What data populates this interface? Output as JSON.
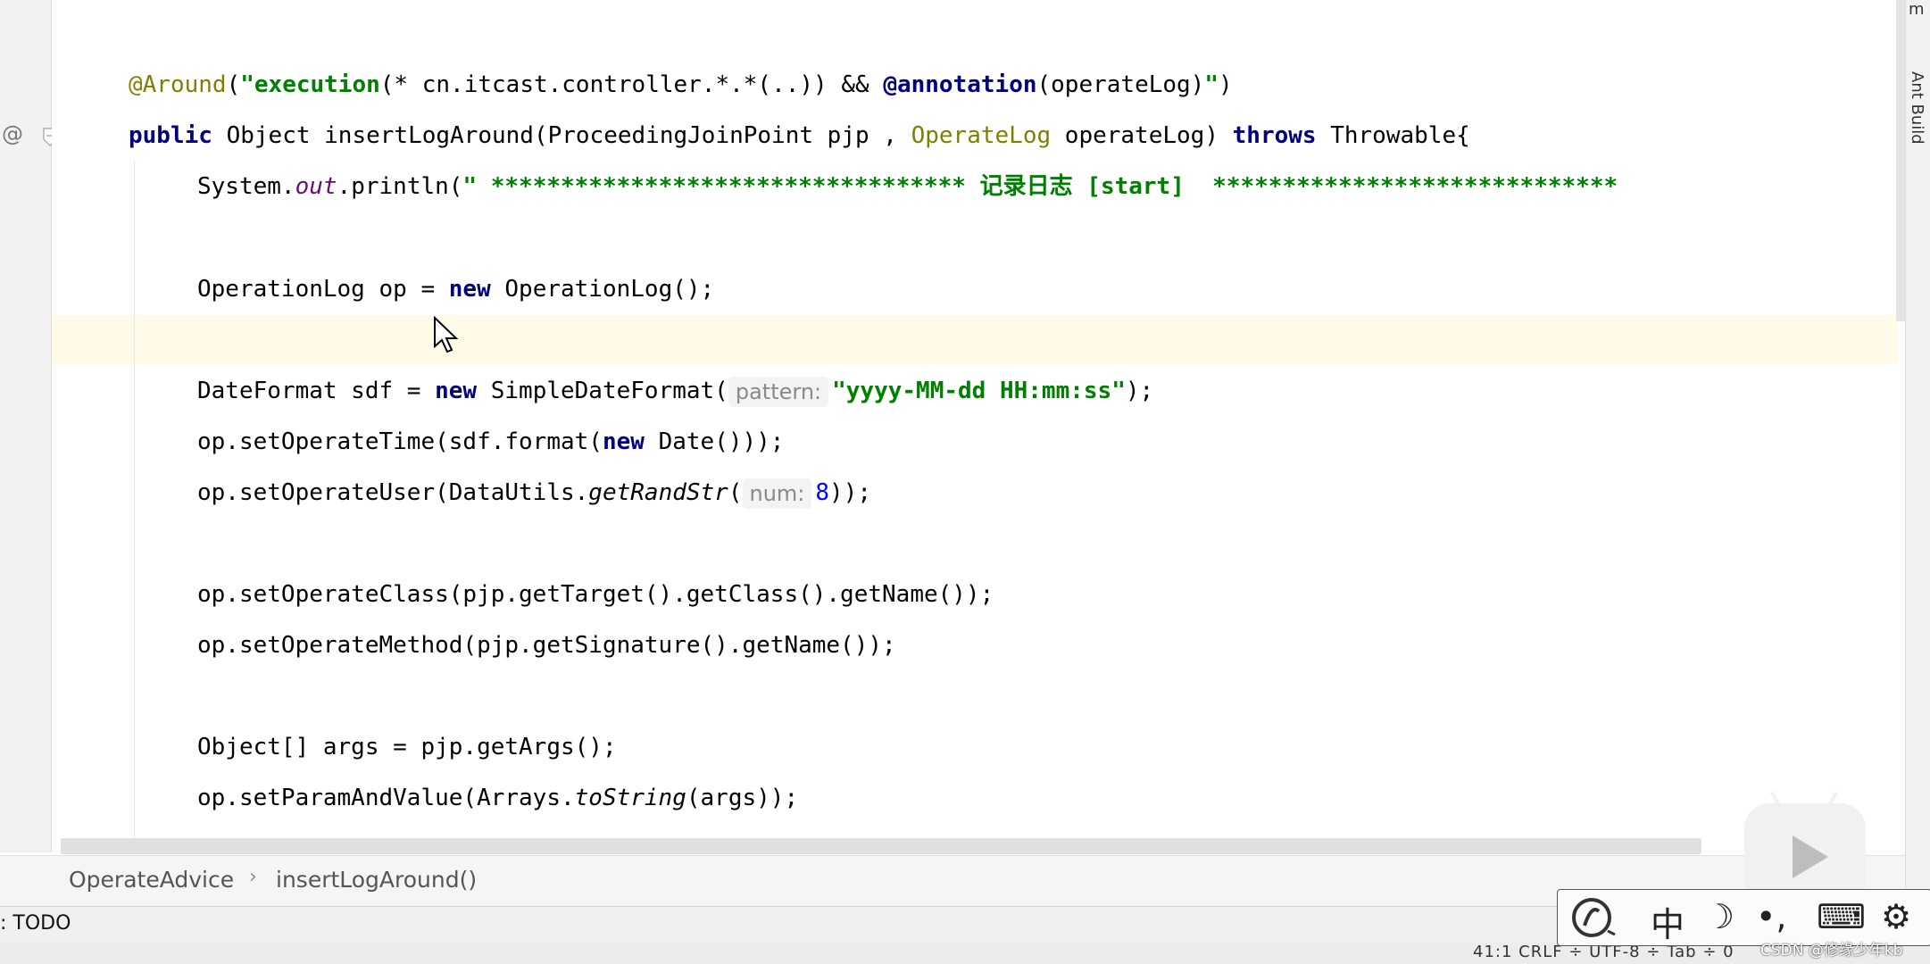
{
  "editor": {
    "lines": {
      "l1": {
        "annotation": "@Around",
        "paren_open": "(",
        "str_open": "\"",
        "kw_execution": "execution",
        "pattern": "(* cn.itcast.controller.*.*(..)) && ",
        "kw_annotation": "@annotation",
        "pattern_end": "(operateLog)",
        "str_close": "\"",
        "paren_close": ")"
      },
      "l2": {
        "kw_public": "public",
        "sig1": " Object insertLogAround(ProceedingJoinPoint pjp , ",
        "type_operate_log": "OperateLog",
        "sig2": " operateLog) ",
        "kw_throws": "throws",
        "sig3": " Throwable{"
      },
      "l3": {
        "system": "System.",
        "out": "out",
        "println": ".println(",
        "str_a": "\" ********************************** ",
        "cjk": "记录日志",
        "str_b": " [start]  *****************************"
      },
      "l4": {
        "a": "OperationLog op = ",
        "kw_new": "new",
        "b": " OperationLog();"
      },
      "l5": {
        "a": "DateFormat sdf = ",
        "kw_new": "new",
        "b": " SimpleDateFormat(",
        "hint": "pattern:",
        "str": "\"yyyy-MM-dd HH:mm:ss\"",
        "c": ");"
      },
      "l6": {
        "a": "op.setOperateTime(sdf.format(",
        "kw_new": "new",
        "b": " Date()));"
      },
      "l7": {
        "a": "op.setOperateUser(DataUtils.",
        "method": "getRandStr",
        "b": "(",
        "hint": "num:",
        "num": "8",
        "c": "));"
      },
      "l8": {
        "text": "op.setOperateClass(pjp.getTarget().getClass().getName());"
      },
      "l9": {
        "text": "op.setOperateMethod(pjp.getSignature().getName());"
      },
      "l10": {
        "text": "Object[] args = pjp.getArgs();"
      },
      "l11": {
        "a": "op.setParamAndValue(Arrays.",
        "method": "toString",
        "b": "(args));"
      }
    },
    "gutter_marker": "@"
  },
  "breadcrumb": {
    "class_name": "OperateAdvice",
    "separator": "›",
    "method_name": "insertLogAround()"
  },
  "bottom_bar": {
    "todo_label": ": TODO"
  },
  "status_bar": {
    "text": "41:1  CRLF ÷  UTF-8 ÷  Tab ÷  0"
  },
  "right_strip": {
    "label": "Ant Build",
    "top_mark": "m"
  },
  "ime_toolbar": {
    "chinese_label": "中",
    "moon": "☽",
    "punct": "•,",
    "keyboard": "⌨",
    "settings": "⚙"
  },
  "watermark": "CSDN @修缘少年kb"
}
